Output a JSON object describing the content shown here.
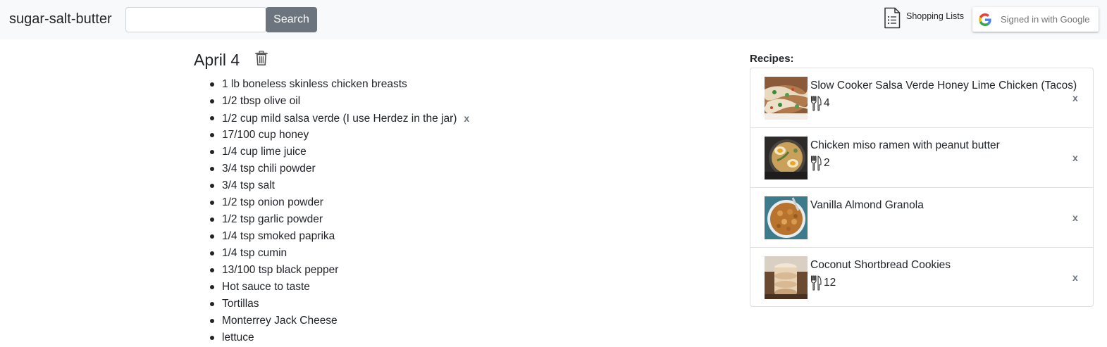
{
  "navbar": {
    "brand": "sugar-salt-butter",
    "search_value": "",
    "search_button": "Search",
    "shopping_lists_label": "Shopping Lists",
    "google_signin_label": "Signed in with Google",
    "search_icon": "magnifier",
    "shopping_icon": "document-list-icon",
    "google_icon": "google-g-logo"
  },
  "day": {
    "title": "April 4",
    "delete_icon": "trash-icon",
    "ingredients": [
      {
        "text": "1 lb boneless skinless chicken breasts",
        "removable": false
      },
      {
        "text": "1/2 tbsp olive oil",
        "removable": false
      },
      {
        "text": "1/2 cup mild salsa verde (I use Herdez in the jar)",
        "removable": true,
        "remove_label": "x"
      },
      {
        "text": "17/100 cup honey",
        "removable": false
      },
      {
        "text": "1/4 cup lime juice",
        "removable": false
      },
      {
        "text": "3/4 tsp chili powder",
        "removable": false
      },
      {
        "text": "3/4 tsp salt",
        "removable": false
      },
      {
        "text": "1/2 tsp onion powder",
        "removable": false
      },
      {
        "text": "1/2 tsp garlic powder",
        "removable": false
      },
      {
        "text": "1/4 tsp smoked paprika",
        "removable": false
      },
      {
        "text": "1/4 tsp cumin",
        "removable": false
      },
      {
        "text": "13/100 tsp black pepper",
        "removable": false
      },
      {
        "text": "Hot sauce to taste",
        "removable": false
      },
      {
        "text": "Tortillas",
        "removable": false
      },
      {
        "text": "Monterrey Jack Cheese",
        "removable": false
      },
      {
        "text": "lettuce",
        "removable": false
      }
    ]
  },
  "recipes": {
    "heading": "Recipes:",
    "items": [
      {
        "name": "Slow Cooker Salsa Verde Honey Lime Chicken (Tacos)",
        "servings": "4",
        "remove_label": "x",
        "thumb": "tacos"
      },
      {
        "name": "Chicken miso ramen with peanut butter",
        "servings": "2",
        "remove_label": "x",
        "thumb": "ramen"
      },
      {
        "name": "Vanilla Almond Granola",
        "servings": "",
        "remove_label": "x",
        "thumb": "granola"
      },
      {
        "name": "Coconut Shortbread Cookies",
        "servings": "12",
        "remove_label": "x",
        "thumb": "cookies"
      }
    ],
    "servings_icon": "fork-knife-icon"
  }
}
